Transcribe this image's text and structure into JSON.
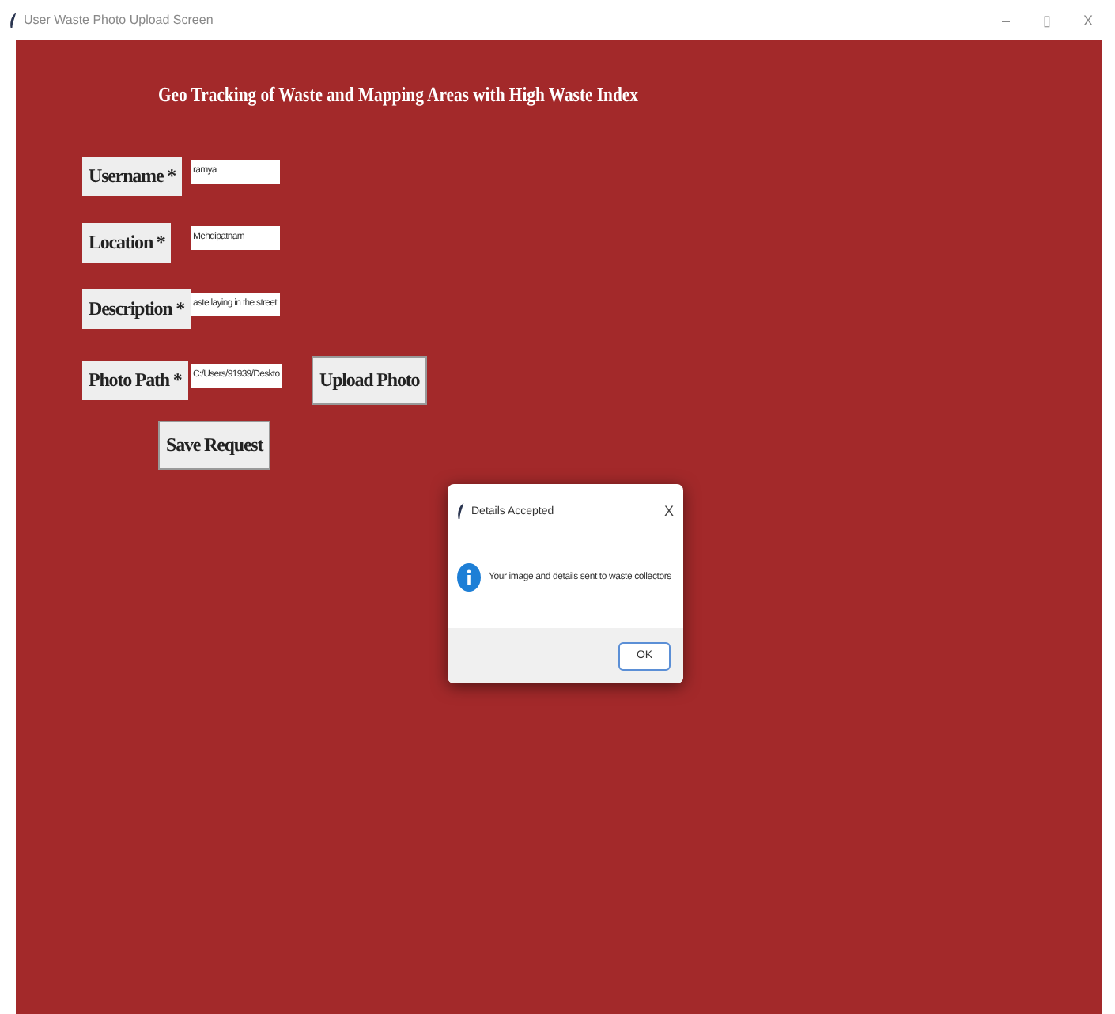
{
  "window": {
    "title": "User Waste Photo Upload Screen",
    "controls": [
      "–",
      "▯",
      "X"
    ]
  },
  "heading": "Geo Tracking of Waste and Mapping Areas with High Waste Index",
  "fields": [
    {
      "label": "Username *",
      "value": "ramya"
    },
    {
      "label": "Location *",
      "value": "Mehdipatnam"
    },
    {
      "label": "Description *",
      "value": "aste laying in the street"
    },
    {
      "label": "Photo Path *",
      "value": "C:/Users/91939/Deskto"
    }
  ],
  "upload_button": "Upload Photo",
  "save_button": "Save Request",
  "dialog": {
    "title": "Details Accepted",
    "close": "X",
    "message": "Your image and details sent to waste collectors",
    "ok": "OK"
  }
}
